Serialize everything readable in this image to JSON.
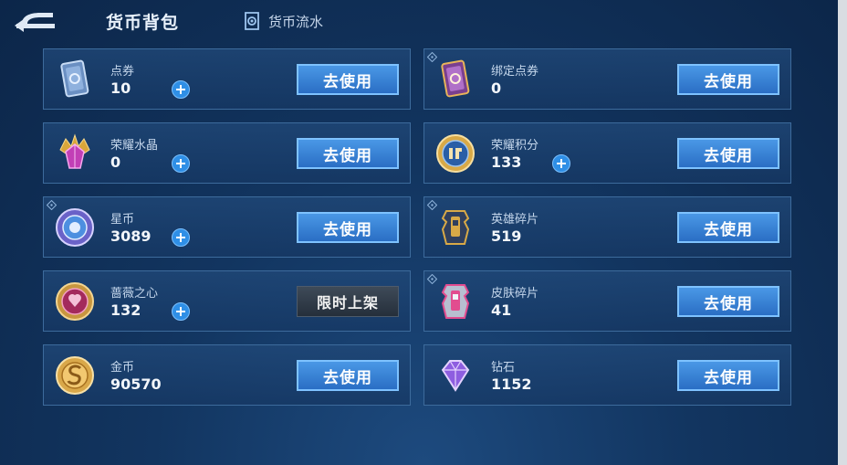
{
  "header": {
    "title": "货币背包",
    "flow_link": "货币流水"
  },
  "cards": [
    {
      "name": "点券",
      "amount": "10",
      "action": "去使用"
    },
    {
      "name": "绑定点券",
      "amount": "0",
      "action": "去使用"
    },
    {
      "name": "荣耀水晶",
      "amount": "0",
      "action": "去使用"
    },
    {
      "name": "荣耀积分",
      "amount": "133",
      "action": "去使用"
    },
    {
      "name": "星币",
      "amount": "3089",
      "action": "去使用"
    },
    {
      "name": "英雄碎片",
      "amount": "519",
      "action": "去使用"
    },
    {
      "name": "蔷薇之心",
      "amount": "132",
      "status": "限时上架"
    },
    {
      "name": "皮肤碎片",
      "amount": "41",
      "action": "去使用"
    },
    {
      "name": "金币",
      "amount": "90570",
      "action": "去使用"
    },
    {
      "name": "钻石",
      "amount": "1152",
      "action": "去使用"
    }
  ],
  "icons": [
    "back-arrow-icon",
    "currency-flow-icon",
    "coupon-card-icon",
    "bound-coupon-card-icon",
    "glory-crystal-icon",
    "glory-points-icon",
    "star-coin-icon",
    "hero-fragment-icon",
    "rose-heart-icon",
    "skin-fragment-icon",
    "gold-coin-icon",
    "diamond-icon",
    "plus-icon",
    "info-tag-icon"
  ],
  "colors": {
    "background": "#123560",
    "card_border": "#3d6b9c",
    "button": "#3a86d8",
    "button_border": "#7ec2ff",
    "limited_badge": "#2f3a47"
  }
}
